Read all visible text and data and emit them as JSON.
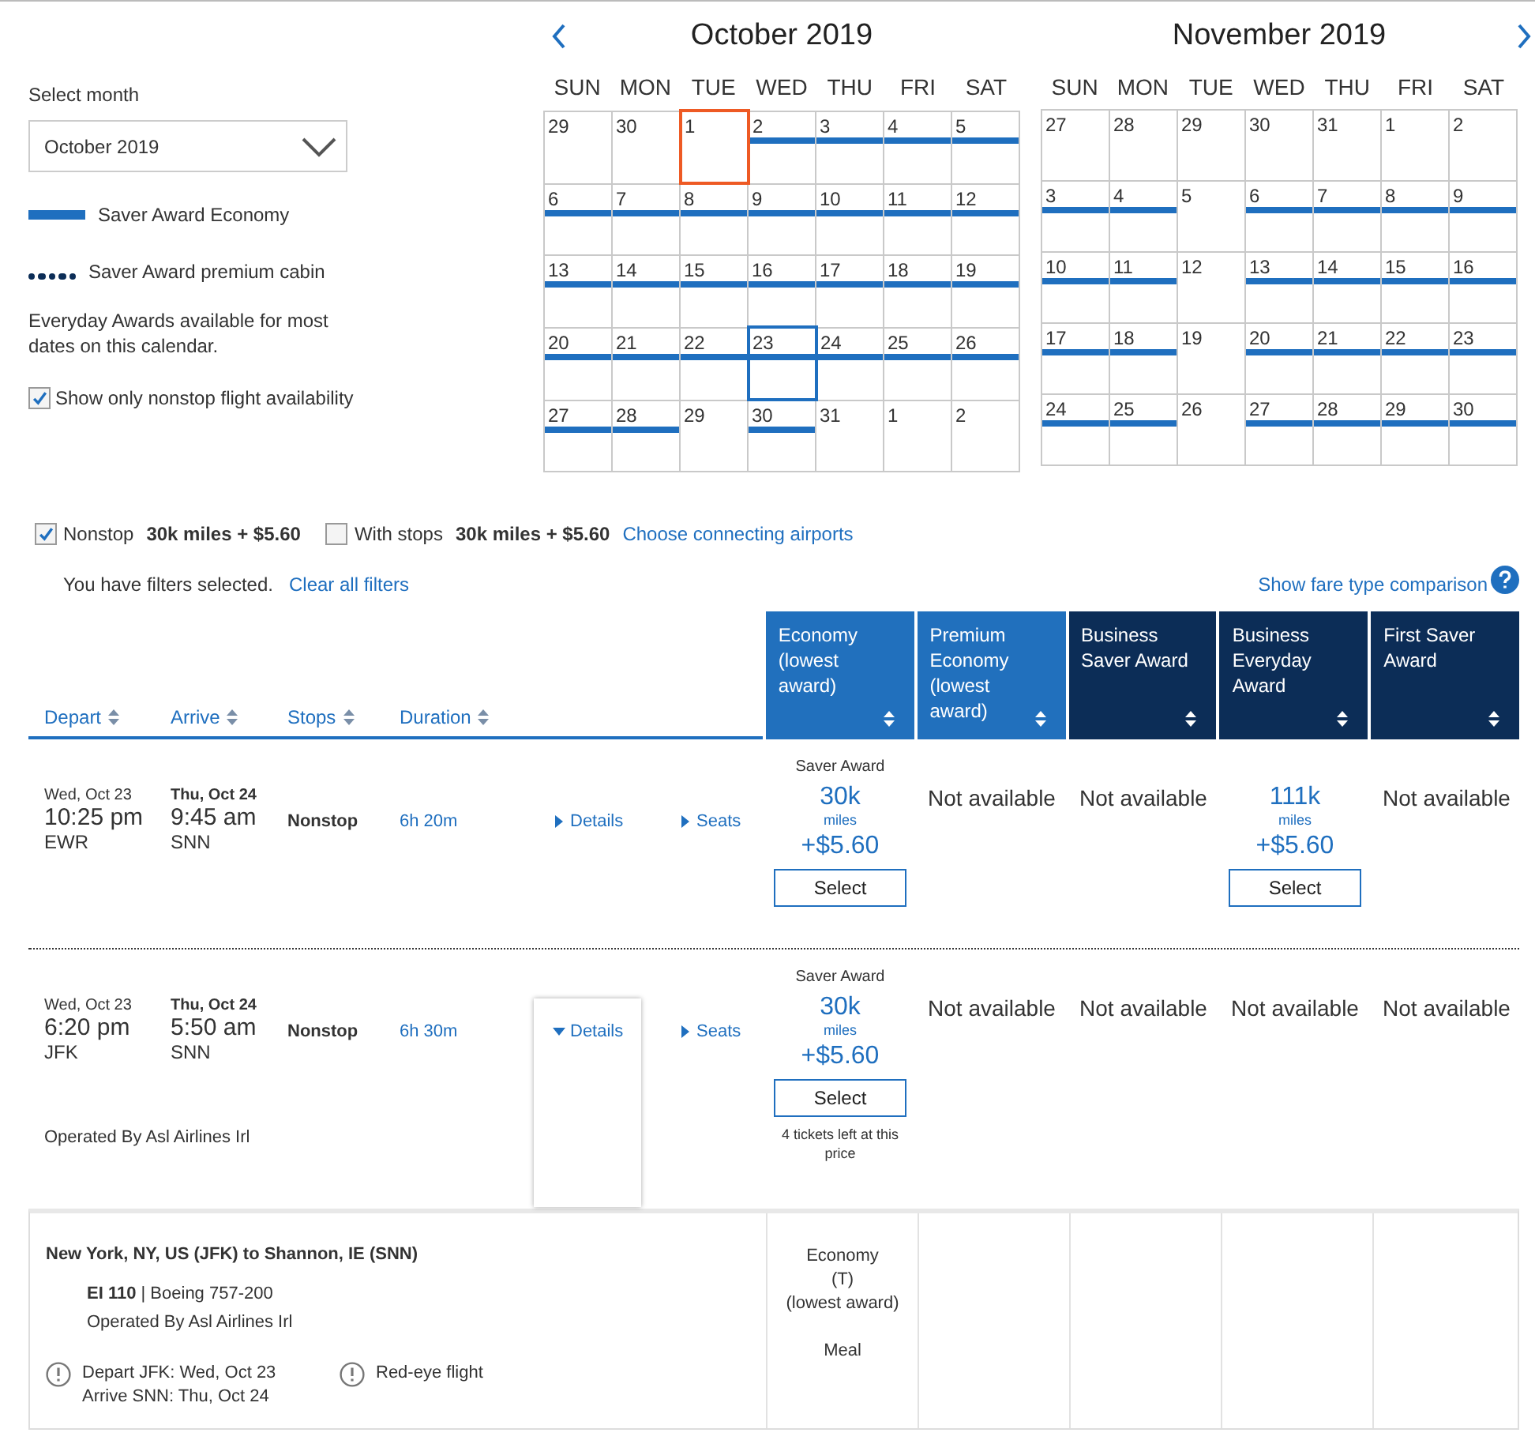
{
  "month_picker": {
    "label": "Select month",
    "value": "October 2019"
  },
  "legend": [
    {
      "kind": "bar",
      "label": "Saver Award Economy",
      "color": "#1f6fbf"
    },
    {
      "kind": "dots",
      "label": "Saver Award premium cabin",
      "color": "#0c2d57"
    }
  ],
  "legend_note": "Everyday Awards available for most dates on this calendar.",
  "nonstop_only": {
    "label": "Show only nonstop flight availability",
    "checked": true
  },
  "calendars": [
    {
      "title": "October 2019",
      "prev_arrow": true,
      "next_arrow": false,
      "weekdays": [
        "SUN",
        "MON",
        "TUE",
        "WED",
        "THU",
        "FRI",
        "SAT"
      ],
      "days": [
        {
          "d": "29",
          "saver": false,
          "selected": false,
          "today": false
        },
        {
          "d": "30",
          "saver": false,
          "selected": false,
          "today": false
        },
        {
          "d": "1",
          "saver": false,
          "selected": false,
          "today": true
        },
        {
          "d": "2",
          "saver": true,
          "selected": false,
          "today": false
        },
        {
          "d": "3",
          "saver": true,
          "selected": false,
          "today": false
        },
        {
          "d": "4",
          "saver": true,
          "selected": false,
          "today": false
        },
        {
          "d": "5",
          "saver": true,
          "selected": false,
          "today": false
        },
        {
          "d": "6",
          "saver": true,
          "selected": false,
          "today": false
        },
        {
          "d": "7",
          "saver": true,
          "selected": false,
          "today": false
        },
        {
          "d": "8",
          "saver": true,
          "selected": false,
          "today": false
        },
        {
          "d": "9",
          "saver": true,
          "selected": false,
          "today": false
        },
        {
          "d": "10",
          "saver": true,
          "selected": false,
          "today": false
        },
        {
          "d": "11",
          "saver": true,
          "selected": false,
          "today": false
        },
        {
          "d": "12",
          "saver": true,
          "selected": false,
          "today": false
        },
        {
          "d": "13",
          "saver": true,
          "selected": false,
          "today": false
        },
        {
          "d": "14",
          "saver": true,
          "selected": false,
          "today": false
        },
        {
          "d": "15",
          "saver": true,
          "selected": false,
          "today": false
        },
        {
          "d": "16",
          "saver": true,
          "selected": false,
          "today": false
        },
        {
          "d": "17",
          "saver": true,
          "selected": false,
          "today": false
        },
        {
          "d": "18",
          "saver": true,
          "selected": false,
          "today": false
        },
        {
          "d": "19",
          "saver": true,
          "selected": false,
          "today": false
        },
        {
          "d": "20",
          "saver": true,
          "selected": false,
          "today": false
        },
        {
          "d": "21",
          "saver": true,
          "selected": false,
          "today": false
        },
        {
          "d": "22",
          "saver": true,
          "selected": false,
          "today": false
        },
        {
          "d": "23",
          "saver": true,
          "selected": true,
          "today": false
        },
        {
          "d": "24",
          "saver": true,
          "selected": false,
          "today": false
        },
        {
          "d": "25",
          "saver": true,
          "selected": false,
          "today": false
        },
        {
          "d": "26",
          "saver": true,
          "selected": false,
          "today": false
        },
        {
          "d": "27",
          "saver": true,
          "selected": false,
          "today": false
        },
        {
          "d": "28",
          "saver": true,
          "selected": false,
          "today": false
        },
        {
          "d": "29",
          "saver": false,
          "selected": false,
          "today": false
        },
        {
          "d": "30",
          "saver": true,
          "selected": false,
          "today": false
        },
        {
          "d": "31",
          "saver": false,
          "selected": false,
          "today": false
        },
        {
          "d": "1",
          "saver": false,
          "selected": false,
          "today": false
        },
        {
          "d": "2",
          "saver": false,
          "selected": false,
          "today": false
        }
      ]
    },
    {
      "title": "November 2019",
      "prev_arrow": false,
      "next_arrow": true,
      "weekdays": [
        "SUN",
        "MON",
        "TUE",
        "WED",
        "THU",
        "FRI",
        "SAT"
      ],
      "days": [
        {
          "d": "27",
          "saver": false,
          "selected": false,
          "today": false
        },
        {
          "d": "28",
          "saver": false,
          "selected": false,
          "today": false
        },
        {
          "d": "29",
          "saver": false,
          "selected": false,
          "today": false
        },
        {
          "d": "30",
          "saver": false,
          "selected": false,
          "today": false
        },
        {
          "d": "31",
          "saver": false,
          "selected": false,
          "today": false
        },
        {
          "d": "1",
          "saver": false,
          "selected": false,
          "today": false
        },
        {
          "d": "2",
          "saver": false,
          "selected": false,
          "today": false
        },
        {
          "d": "3",
          "saver": true,
          "selected": false,
          "today": false
        },
        {
          "d": "4",
          "saver": true,
          "selected": false,
          "today": false
        },
        {
          "d": "5",
          "saver": false,
          "selected": false,
          "today": false
        },
        {
          "d": "6",
          "saver": true,
          "selected": false,
          "today": false
        },
        {
          "d": "7",
          "saver": true,
          "selected": false,
          "today": false
        },
        {
          "d": "8",
          "saver": true,
          "selected": false,
          "today": false
        },
        {
          "d": "9",
          "saver": true,
          "selected": false,
          "today": false
        },
        {
          "d": "10",
          "saver": true,
          "selected": false,
          "today": false
        },
        {
          "d": "11",
          "saver": true,
          "selected": false,
          "today": false
        },
        {
          "d": "12",
          "saver": false,
          "selected": false,
          "today": false
        },
        {
          "d": "13",
          "saver": true,
          "selected": false,
          "today": false
        },
        {
          "d": "14",
          "saver": true,
          "selected": false,
          "today": false
        },
        {
          "d": "15",
          "saver": true,
          "selected": false,
          "today": false
        },
        {
          "d": "16",
          "saver": true,
          "selected": false,
          "today": false
        },
        {
          "d": "17",
          "saver": true,
          "selected": false,
          "today": false
        },
        {
          "d": "18",
          "saver": true,
          "selected": false,
          "today": false
        },
        {
          "d": "19",
          "saver": false,
          "selected": false,
          "today": false
        },
        {
          "d": "20",
          "saver": true,
          "selected": false,
          "today": false
        },
        {
          "d": "21",
          "saver": true,
          "selected": false,
          "today": false
        },
        {
          "d": "22",
          "saver": true,
          "selected": false,
          "today": false
        },
        {
          "d": "23",
          "saver": true,
          "selected": false,
          "today": false
        },
        {
          "d": "24",
          "saver": true,
          "selected": false,
          "today": false
        },
        {
          "d": "25",
          "saver": true,
          "selected": false,
          "today": false
        },
        {
          "d": "26",
          "saver": false,
          "selected": false,
          "today": false
        },
        {
          "d": "27",
          "saver": true,
          "selected": false,
          "today": false
        },
        {
          "d": "28",
          "saver": true,
          "selected": false,
          "today": false
        },
        {
          "d": "29",
          "saver": true,
          "selected": false,
          "today": false
        },
        {
          "d": "30",
          "saver": true,
          "selected": false,
          "today": false
        }
      ]
    }
  ],
  "filters": [
    {
      "label": "Nonstop",
      "checked": true,
      "price": "30k miles + $5.60"
    },
    {
      "label": "With stops",
      "checked": false,
      "price": "30k miles + $5.60"
    }
  ],
  "connecting_link": "Choose connecting airports",
  "filter_status": "You have filters selected.",
  "clear_link": "Clear all filters",
  "comparison_link": "Show fare type comparison",
  "sort_columns": [
    "Depart",
    "Arrive",
    "Stops",
    "Duration"
  ],
  "fare_columns": [
    {
      "label": "Economy (lowest award)",
      "color": "#2170bd"
    },
    {
      "label": "Premium Economy (lowest award)",
      "color": "#2170bd"
    },
    {
      "label": "Business Saver Award",
      "color": "#0c2d57"
    },
    {
      "label": "Business Everyday Award",
      "color": "#0c2d57"
    },
    {
      "label": "First Saver Award",
      "color": "#0c2d57"
    }
  ],
  "flights": [
    {
      "depart": {
        "date": "Wed, Oct 23",
        "time": "10:25 pm",
        "airport": "EWR"
      },
      "arrive": {
        "date": "Thu, Oct 24",
        "time": "9:45 am",
        "airport": "SNN"
      },
      "stops": "Nonstop",
      "duration": "6h 20m",
      "details": {
        "label": "Details",
        "expanded": false
      },
      "seats": "Seats",
      "fares": [
        {
          "kind": "award",
          "label": "Saver Award",
          "miles": "30k",
          "unit": "miles",
          "fee": "+$5.60",
          "button": "Select"
        },
        {
          "kind": "na",
          "text": "Not available"
        },
        {
          "kind": "na",
          "text": "Not available"
        },
        {
          "kind": "award",
          "miles": "111k",
          "unit": "miles",
          "fee": "+$5.60",
          "button": "Select"
        },
        {
          "kind": "na",
          "text": "Not available"
        }
      ]
    },
    {
      "depart": {
        "date": "Wed, Oct 23",
        "time": "6:20 pm",
        "airport": "JFK"
      },
      "arrive": {
        "date": "Thu, Oct 24",
        "time": "5:50 am",
        "airport": "SNN"
      },
      "operated": "Operated By Asl Airlines Irl",
      "stops": "Nonstop",
      "duration": "6h 30m",
      "details": {
        "label": "Details",
        "expanded": true
      },
      "seats": "Seats",
      "fares": [
        {
          "kind": "award",
          "label": "Saver Award",
          "miles": "30k",
          "unit": "miles",
          "fee": "+$5.60",
          "button": "Select",
          "note": "4 tickets left at this price"
        },
        {
          "kind": "na",
          "text": "Not available"
        },
        {
          "kind": "na",
          "text": "Not available"
        },
        {
          "kind": "na",
          "text": "Not available"
        },
        {
          "kind": "na",
          "text": "Not available"
        }
      ]
    }
  ],
  "flight_detail": {
    "route": "New York, NY, US (JFK) to Shannon, IE (SNN)",
    "flight": "**EI 110** | Boeing 757-200",
    "operated": "Operated By Asl Airlines Irl",
    "notices": [
      {
        "lines": [
          "Depart JFK: Wed, Oct 23",
          "Arrive SNN: Thu, Oct 24"
        ]
      },
      {
        "lines": [
          "Red-eye flight"
        ]
      }
    ],
    "cabin": [
      "Economy",
      "(T)",
      "(lowest award)"
    ],
    "meal": "Meal"
  }
}
